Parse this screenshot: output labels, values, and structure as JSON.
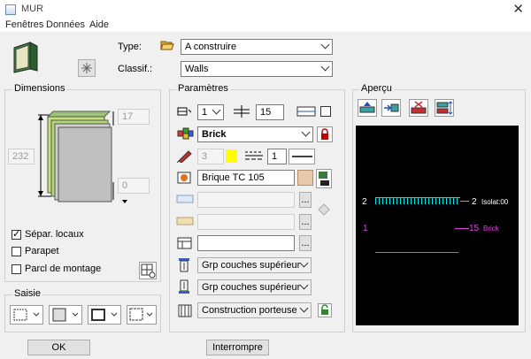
{
  "window": {
    "title": "MUR",
    "close": "✕"
  },
  "menu": [
    "Fenêtres",
    "Données",
    "Aide"
  ],
  "header": {
    "type_label": "Type:",
    "type_value": "A construire",
    "classif_label": "Classif.:",
    "classif_value": "Walls"
  },
  "dimensions": {
    "title": "Dimensions",
    "top_value": "17",
    "height_value": "232",
    "bottom_value": "0",
    "separ_locaux": "Sépar. locaux",
    "separ_checked": true,
    "parapet": "Parapet",
    "parapet_checked": false,
    "parcl": "Parcl de montage",
    "parcl_checked": false
  },
  "saisie": {
    "title": "Saisie"
  },
  "parametres": {
    "title": "Paramètres",
    "layers_value": "1",
    "thickness_value": "15",
    "material": "Brick",
    "pen_value": "3",
    "pen_color": "#ffff00",
    "line_value": "1",
    "hatch_name": "Brique TC 105",
    "group_top_1": "Grp couches supérieur",
    "group_top_2": "Grp couches supérieur",
    "construction": "Construction porteuse",
    "ellipsis": "..."
  },
  "apercu": {
    "title": "Aperçu",
    "line1_left": "2",
    "line1_right": "2",
    "line1_label": "Isolat:00",
    "line2_left": "1",
    "line2_right": "15",
    "line2_label": "Brick",
    "cyan": "#00e5e5",
    "magenta": "#e040e0"
  },
  "buttons": {
    "ok": "OK",
    "cancel": "Interrompre"
  }
}
